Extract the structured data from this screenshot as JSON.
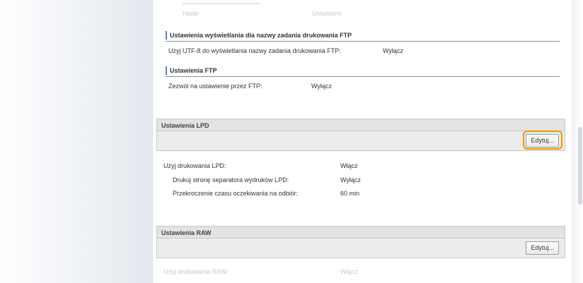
{
  "top_ghost": {
    "row1_label": "Hasło",
    "row1_value": "Ustawiono"
  },
  "ftp_display": {
    "heading": "Ustawienia wyświetlania dla nazwy zadania drukowania FTP",
    "label": "Użyj UTF-8 do wyświetlania nazwy zadania drukowania FTP:",
    "value": "Wyłącz"
  },
  "ftp": {
    "heading": "Ustawienia FTP",
    "label": "Zezwól na ustawienie przez FTP:",
    "value": "Wyłącz"
  },
  "lpd": {
    "title": "Ustawienia LPD",
    "edit_label": "Edytuj...",
    "rows": [
      {
        "label": "Użyj drukowania LPD:",
        "value": "Włącz"
      },
      {
        "label": "Drukuj stronę separatora wydruków LPD:",
        "value": "Wyłącz"
      },
      {
        "label": "Przekroczenie czasu oczekiwania na odbiór:",
        "value": "60 min"
      }
    ]
  },
  "raw": {
    "title": "Ustawienia RAW",
    "edit_label": "Edytuj...",
    "ghost_label": "Użyj drukowania RAW:",
    "ghost_value": "Włącz"
  },
  "colors": {
    "highlight": "#f39800",
    "heading_accent": "#5a7db5",
    "section_bar": "#e3e3e3"
  }
}
